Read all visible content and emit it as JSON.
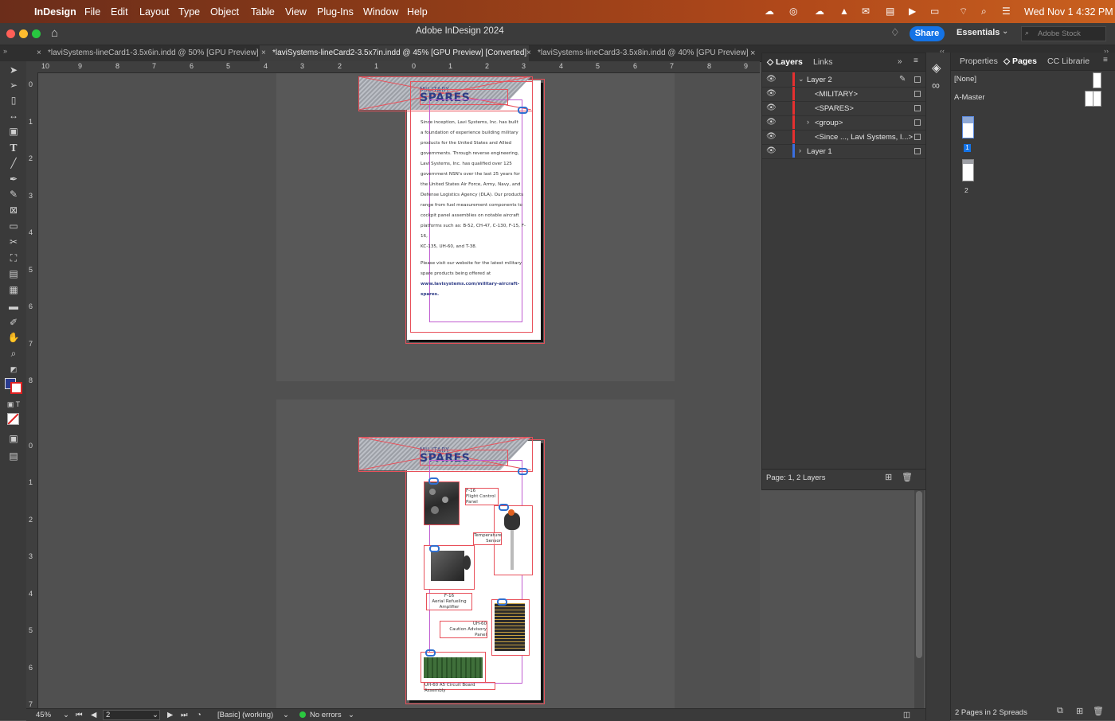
{
  "menubar": {
    "apple_icon": "apple-icon",
    "app_name": "InDesign",
    "items": [
      "File",
      "Edit",
      "Layout",
      "Type",
      "Object",
      "Table",
      "View",
      "Plug-Ins",
      "Window",
      "Help"
    ],
    "datetime": "Wed Nov 1  4:32 PM"
  },
  "appbar": {
    "title": "Adobe InDesign 2024",
    "share_label": "Share",
    "workspace": "Essentials",
    "stock_placeholder": "Adobe Stock"
  },
  "tabs": [
    {
      "label": "*laviSystems-lineCard1-3.5x6in.indd @ 50% [GPU Preview]",
      "active": false
    },
    {
      "label": "*laviSystems-lineCard2-3.5x7in.indd @ 45% [GPU Preview] [Converted]",
      "active": true
    },
    {
      "label": "*laviSystems-lineCard3-3.5x8in.indd @ 40% [GPU Preview]",
      "active": false
    }
  ],
  "ruler": {
    "h_ticks": [
      "10",
      "9",
      "8",
      "7",
      "6",
      "5",
      "4",
      "3",
      "2",
      "1",
      "0",
      "1",
      "2",
      "3",
      "4",
      "5",
      "6",
      "7",
      "8",
      "9"
    ],
    "v_ticks_top": [
      "0",
      "1",
      "2",
      "3",
      "4",
      "5",
      "6",
      "7",
      "8"
    ],
    "v_ticks_bottom": [
      "0",
      "1",
      "2",
      "3",
      "4",
      "5",
      "6",
      "7"
    ]
  },
  "document": {
    "logo_top": "MILITARY",
    "logo_bottom": "SPARES",
    "body_lines": [
      "Since inception, Lavi Systems, Inc. has built",
      "a foundation of experience building military",
      "products for the United States and Allied",
      "governments. Through reverse engineering,",
      "Lavi Systems, Inc. has qualified over 125",
      "government NSN's over the last 25 years for",
      "the United States Air Force, Army, Navy, and",
      "Defense Logistics Agency (DLA). Our products",
      "range from fuel measurement components to",
      "cockpit panel assemblies on notable aircraft",
      "platforms such as: B-52, CH-47, C-130, F-15, F-16,",
      "KC-135, UH-60, and T-38."
    ],
    "visit_lines": [
      "Please visit our website for the latest military",
      "spare products being offered at"
    ],
    "url": "www.lavisystems.com/military-aircraft-spares.",
    "captions": {
      "c1": "F-16\nFlight Control\nPanel",
      "c2": "Temperature\nSensor",
      "c3": "F-16\nAerial Refueling\nAmplifier",
      "c4": "UH-60\nCaution Advisory\nPanel",
      "c5": "UH-60 A5 Circuit Board Assembly"
    }
  },
  "statusbar": {
    "zoom": "45%",
    "page": "2",
    "style": "[Basic] (working)",
    "errors": "No errors"
  },
  "layers_panel": {
    "tabs": [
      "Layers",
      "Links"
    ],
    "rows": [
      {
        "name": "Layer 2",
        "indent": 0,
        "expanded": true
      },
      {
        "name": "<MILITARY>",
        "indent": 1
      },
      {
        "name": "<SPARES>",
        "indent": 1
      },
      {
        "name": "<group>",
        "indent": 1,
        "collapsed": true
      },
      {
        "name": "<Since ..., Lavi Systems, I...>",
        "indent": 1
      },
      {
        "name": "Layer 1",
        "indent": 0,
        "collapsed": true
      }
    ],
    "footer": "Page: 1, 2 Layers",
    "colors": {
      "layer2": "#e53030",
      "layer1": "#3a6fe0"
    }
  },
  "pages_panel": {
    "tabs": [
      "Properties",
      "Pages",
      "CC Librarie"
    ],
    "none_label": "[None]",
    "master_label": "A-Master",
    "page1_num": "1",
    "page2_num": "2",
    "footer": "2 Pages in 2 Spreads"
  }
}
